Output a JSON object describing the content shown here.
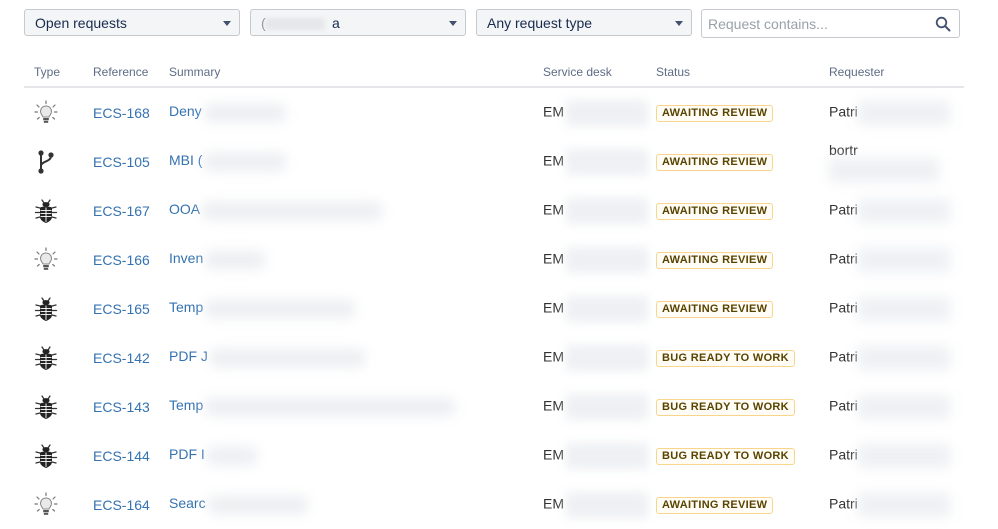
{
  "filters": {
    "status_select": "Open requests",
    "person_select": "a",
    "person_select_prefix": "(",
    "type_select": "Any request type",
    "search_placeholder": "Request contains..."
  },
  "table": {
    "headers": [
      "Type",
      "Reference",
      "Summary",
      "Service desk",
      "Status",
      "Requester"
    ],
    "rows": [
      {
        "type_icon": "lightbulb-icon",
        "ref": "ECS-168",
        "summary": "Deny",
        "desk": "EM",
        "status": "AWAITING REVIEW",
        "requester": "Patri"
      },
      {
        "type_icon": "branch-icon",
        "ref": "ECS-105",
        "summary": "MBI (",
        "desk": "EM",
        "status": "AWAITING REVIEW",
        "requester": "bortr"
      },
      {
        "type_icon": "bug-icon",
        "ref": "ECS-167",
        "summary": "OOA",
        "desk": "EM",
        "status": "AWAITING REVIEW",
        "requester": "Patri"
      },
      {
        "type_icon": "lightbulb-icon",
        "ref": "ECS-166",
        "summary": "Inven",
        "desk": "EM",
        "status": "AWAITING REVIEW",
        "requester": "Patri"
      },
      {
        "type_icon": "bug-icon",
        "ref": "ECS-165",
        "summary": "Temp",
        "desk": "EM",
        "status": "AWAITING REVIEW",
        "requester": "Patri"
      },
      {
        "type_icon": "bug-icon",
        "ref": "ECS-142",
        "summary": "PDF J",
        "desk": "EM",
        "status": "BUG READY TO WORK",
        "requester": "Patri"
      },
      {
        "type_icon": "bug-icon",
        "ref": "ECS-143",
        "summary": "Temp",
        "desk": "EM",
        "status": "BUG READY TO WORK",
        "requester": "Patri"
      },
      {
        "type_icon": "bug-icon",
        "ref": "ECS-144",
        "summary": "PDF I",
        "desk": "EM",
        "status": "BUG READY TO WORK",
        "requester": "Patri"
      },
      {
        "type_icon": "lightbulb-icon",
        "ref": "ECS-164",
        "summary": "Searc",
        "desk": "EM",
        "status": "AWAITING REVIEW",
        "requester": "Patri"
      }
    ]
  },
  "colors": {
    "link": "#3572b0",
    "lozenge_border": "#f7d58c",
    "lozenge_text": "#594300"
  }
}
